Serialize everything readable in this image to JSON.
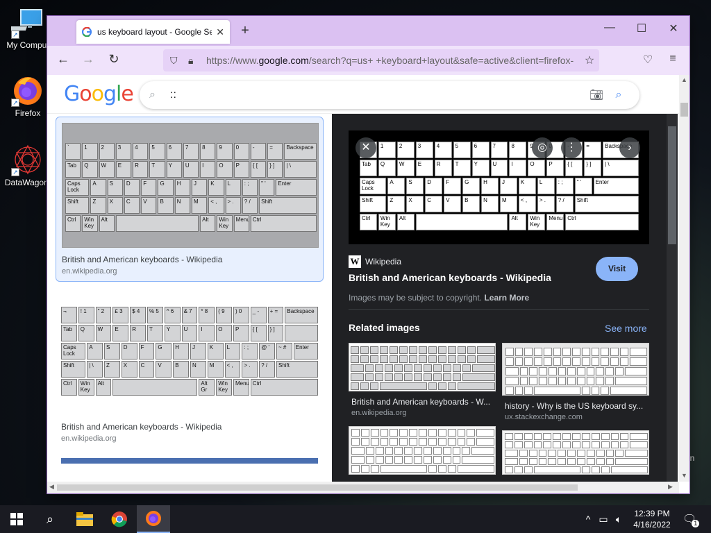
{
  "desktop": {
    "icons": [
      {
        "label": "My Comput",
        "icon": "computer-icon"
      },
      {
        "label": "Firefox",
        "icon": "firefox-icon"
      },
      {
        "label": "DataWagon.",
        "icon": "datawagon-icon"
      }
    ],
    "peek_text": "in"
  },
  "browser": {
    "tab_title": "us keyboard layout - Google Se",
    "url_prefix": "https://www.",
    "url_domain": "google.com",
    "url_rest": "/search?q=us+ +keyboard+layout&safe=active&client=firefox-",
    "accent": "#dbc1f2"
  },
  "google": {
    "logo": "Google",
    "search_value": "::"
  },
  "results": [
    {
      "title": "British and American keyboards - Wikipedia",
      "source": "en.wikipedia.org",
      "selected": true
    },
    {
      "title": "British and American keyboards - Wikipedia",
      "source": "en.wikipedia.org",
      "selected": false
    }
  ],
  "keyboard_us": {
    "row1_top": [
      "~",
      "!",
      "@",
      "#",
      "$",
      "%",
      "^",
      "&",
      "*",
      "(",
      ")",
      "_",
      "+",
      "←"
    ],
    "row1": [
      "`",
      "1",
      "2",
      "3",
      "4",
      "5",
      "6",
      "7",
      "8",
      "9",
      "0",
      "-",
      "=",
      "Backspace"
    ],
    "row2": [
      "Tab",
      "Q",
      "W",
      "E",
      "R",
      "T",
      "Y",
      "U",
      "I",
      "O",
      "P",
      "{ [",
      "} ]",
      "| \\"
    ],
    "row3": [
      "Caps Lock",
      "A",
      "S",
      "D",
      "F",
      "G",
      "H",
      "J",
      "K",
      "L",
      ": ;",
      "\" '",
      "Enter"
    ],
    "row4": [
      "Shift",
      "Z",
      "X",
      "C",
      "V",
      "B",
      "N",
      "M",
      "< ,",
      "> .",
      "? /",
      "Shift"
    ],
    "row5": [
      "Ctrl",
      "Win Key",
      "Alt",
      "",
      "Alt",
      "Win Key",
      "Menu",
      "Ctrl"
    ]
  },
  "keyboard_uk": {
    "row1": [
      "¬",
      "! 1",
      "\" 2",
      "£ 3",
      "$ 4",
      "% 5",
      "^ 6",
      "& 7",
      "* 8",
      "( 9",
      ") 0",
      "_ -",
      "+ =",
      "Backspace"
    ],
    "row2": [
      "Tab",
      "Q",
      "W",
      "E",
      "R",
      "T",
      "Y",
      "U",
      "I",
      "O",
      "P",
      "{ [",
      "} ]",
      ""
    ],
    "row3": [
      "Caps Lock",
      "A",
      "S",
      "D",
      "F",
      "G",
      "H",
      "J",
      "K",
      "L",
      ": ;",
      "@ '",
      "~ #",
      "Enter"
    ],
    "row4": [
      "Shift",
      "| \\",
      "Z",
      "X",
      "C",
      "V",
      "B",
      "N",
      "M",
      "< ,",
      "> .",
      "? /",
      "Shift"
    ],
    "row5": [
      "Ctrl",
      "Win Key",
      "Alt",
      "",
      "Alt Gr",
      "Win Key",
      "Menu",
      "Ctrl"
    ]
  },
  "panel": {
    "source_name": "Wikipedia",
    "title": "British and American keyboards - Wikipedia",
    "visit_label": "Visit",
    "copyright_text": "Images may be subject to copyright.",
    "learn_more": "Learn More",
    "related_heading": "Related images",
    "see_more": "See more",
    "related": [
      {
        "title": "British and American keyboards - W...",
        "source": "en.wikipedia.org"
      },
      {
        "title": "history - Why is the US keyboard sy...",
        "source": "ux.stackexchange.com"
      },
      {
        "title": "",
        "source": ""
      },
      {
        "title": "",
        "source": ""
      }
    ]
  },
  "taskbar": {
    "time": "12:39 PM",
    "date": "4/16/2022",
    "notification_count": "1"
  }
}
